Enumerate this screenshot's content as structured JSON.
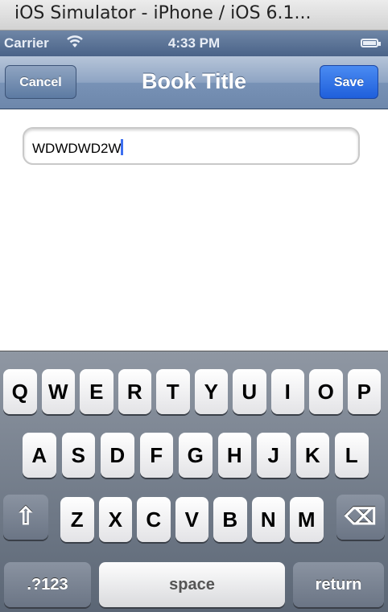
{
  "window": {
    "title": "iOS Simulator - iPhone / iOS 6.1..."
  },
  "status_bar": {
    "carrier": "Carrier",
    "time": "4:33 PM"
  },
  "nav_bar": {
    "title": "Book Title",
    "cancel_label": "Cancel",
    "save_label": "Save"
  },
  "form": {
    "title_value": "WDWDWD2W"
  },
  "keyboard": {
    "row1": [
      "Q",
      "W",
      "E",
      "R",
      "T",
      "Y",
      "U",
      "I",
      "O",
      "P"
    ],
    "row2": [
      "A",
      "S",
      "D",
      "F",
      "G",
      "H",
      "J",
      "K",
      "L"
    ],
    "row3": [
      "Z",
      "X",
      "C",
      "V",
      "B",
      "N",
      "M"
    ],
    "shift_glyph": "⇧",
    "delete_glyph": "⌫",
    "numbers_label": ".?123",
    "space_label": "space",
    "return_label": "return"
  },
  "colors": {
    "save_blue": "#2f6fe6",
    "nav_blue": "#7b94b8"
  }
}
